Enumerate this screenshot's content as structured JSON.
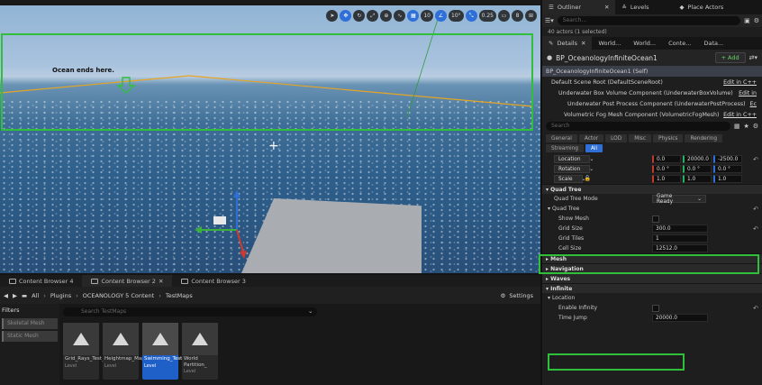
{
  "viewport": {
    "annotation": "Ocean ends here.",
    "toolbar": {
      "grid_size": "10",
      "rotation_snap": "10°",
      "scale_snap": "0.25",
      "camera_speed": "8"
    }
  },
  "content_browser": {
    "tabs": [
      {
        "label": "Content Browser 4"
      },
      {
        "label": "Content Browser 2"
      },
      {
        "label": "Content Browser 3"
      }
    ],
    "path": [
      "All",
      "Plugins",
      "OCEANOLOGY 5 Content",
      "TestMaps"
    ],
    "settings_label": "Settings",
    "filters_label": "Filters",
    "filters": [
      "Skeletal Mesh",
      "Static Mesh"
    ],
    "search_placeholder": "Search TestMaps",
    "assets": [
      {
        "name": "Grid_Rays_Test_Map",
        "type": "Level"
      },
      {
        "name": "Heightmap_Map",
        "type": "Level"
      },
      {
        "name": "Swimming_Test_Map",
        "type": "Level"
      },
      {
        "name": "World Partition_",
        "type": "Level"
      }
    ]
  },
  "outliner": {
    "tabs": [
      "Outliner",
      "Levels",
      "Place Actors"
    ],
    "search_placeholder": "Search...",
    "actor_count": "40 actors (1 selected)"
  },
  "details": {
    "tabs": [
      "Details",
      "World...",
      "World...",
      "Conte...",
      "Data..."
    ],
    "actor_name": "BP_OceanologyInfiniteOcean1",
    "add_label": "+ Add",
    "components": [
      {
        "label": "BP_OceanologyInfiniteOcean1 (Self)",
        "edit": ""
      },
      {
        "label": "Default Scene Root (DefaultSceneRoot)",
        "edit": "Edit in C++"
      },
      {
        "label": "Underwater Box Volume Component (UnderwaterBoxVolume)",
        "edit": "Edit in"
      },
      {
        "label": "Underwater Post Process Component (UnderwaterPostProcess)",
        "edit": "Ec"
      },
      {
        "label": "Volumetric Fog Mesh Component (VolumetricFogMesh)",
        "edit": "Edit in C++"
      }
    ],
    "search_placeholder": "Search",
    "categories_row1": [
      "General",
      "Actor",
      "LOD",
      "Misc",
      "Physics",
      "Rendering"
    ],
    "categories_row2": [
      "Streaming",
      "All"
    ],
    "transform": {
      "location_label": "Location",
      "location": [
        "0.0",
        "20000.0",
        "-2500.0"
      ],
      "rotation_label": "Rotation",
      "rotation": [
        "0.0 °",
        "0.0 °",
        "0.0 °"
      ],
      "scale_label": "Scale",
      "scale": [
        "1.0",
        "1.0",
        "1.0"
      ]
    },
    "quad_tree": {
      "section": "Quad Tree",
      "mode_label": "Quad Tree Mode",
      "mode_value": "Game Ready",
      "sub_section": "Quad Tree",
      "show_mesh_label": "Show Mesh",
      "grid_size_label": "Grid Size",
      "grid_size_value": "300.0",
      "grid_tiles_label": "Grid Tiles",
      "grid_tiles_value": "1",
      "cell_size_label": "Cell Size",
      "cell_size_value": "12512.0"
    },
    "sections": [
      "Mesh",
      "Navigation",
      "Waves",
      "Infinite"
    ],
    "infinite": {
      "location_section": "Location",
      "enable_infinity_label": "Enable Infinity",
      "time_jump_label": "Time Jump",
      "time_jump_value": "20000.0"
    }
  }
}
